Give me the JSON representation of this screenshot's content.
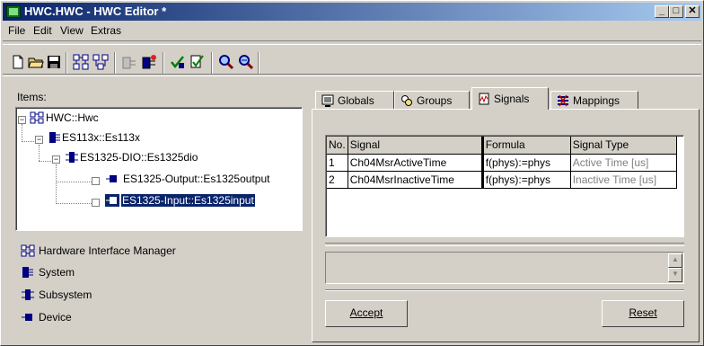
{
  "window": {
    "title": "HWC.HWC - HWC Editor  *",
    "min": "_",
    "max": "□",
    "close": "✕"
  },
  "menu": [
    "File",
    "Edit",
    "View",
    "Extras"
  ],
  "toolbar": [
    "new-file-icon",
    "open-folder-icon",
    "save-icon",
    "tree-icon",
    "tree-icon",
    "add-node-icon",
    "add-node-icon",
    "check-icon",
    "check-icon",
    "search-icon",
    "search-icon"
  ],
  "left": {
    "items_label": "Items:",
    "tree": [
      {
        "label": "HWC::Hwc",
        "expander": "−"
      },
      {
        "label": "ES113x::Es113x",
        "expander": "−"
      },
      {
        "label": "ES1325-DIO::Es1325dio",
        "expander": "−"
      },
      {
        "label": "ES1325-Output::Es1325output",
        "expander": ""
      },
      {
        "label": "ES1325-Input::Es1325input",
        "expander": "",
        "selected": true
      }
    ],
    "legend": [
      {
        "label": "Hardware Interface Manager",
        "icon": "hardware-interface-manager-icon"
      },
      {
        "label": "System",
        "icon": "system-icon"
      },
      {
        "label": "Subsystem",
        "icon": "subsystem-icon"
      },
      {
        "label": "Device",
        "icon": "device-icon"
      }
    ]
  },
  "tabs": [
    {
      "label": "Globals",
      "icon": "globals-icon"
    },
    {
      "label": "Groups",
      "icon": "groups-icon"
    },
    {
      "label": "Signals",
      "icon": "signals-icon",
      "active": true
    },
    {
      "label": "Mappings",
      "icon": "mappings-icon"
    }
  ],
  "grid": {
    "headers": [
      "No.",
      "Signal",
      "Formula",
      "Signal Type"
    ],
    "rows": [
      [
        "1",
        "Ch04MsrActiveTime",
        "f(phys):=phys",
        "Active Time [us]"
      ],
      [
        "2",
        "Ch04MsrInactiveTime",
        "f(phys):=phys",
        "Inactive Time [us]"
      ]
    ]
  },
  "buttons": {
    "accept": "Accept",
    "reset": "Reset"
  },
  "colors": {
    "title_start": "#0a246a",
    "title_end": "#a6caf0",
    "selection": "#0a246a",
    "face": "#d4d0c8"
  }
}
